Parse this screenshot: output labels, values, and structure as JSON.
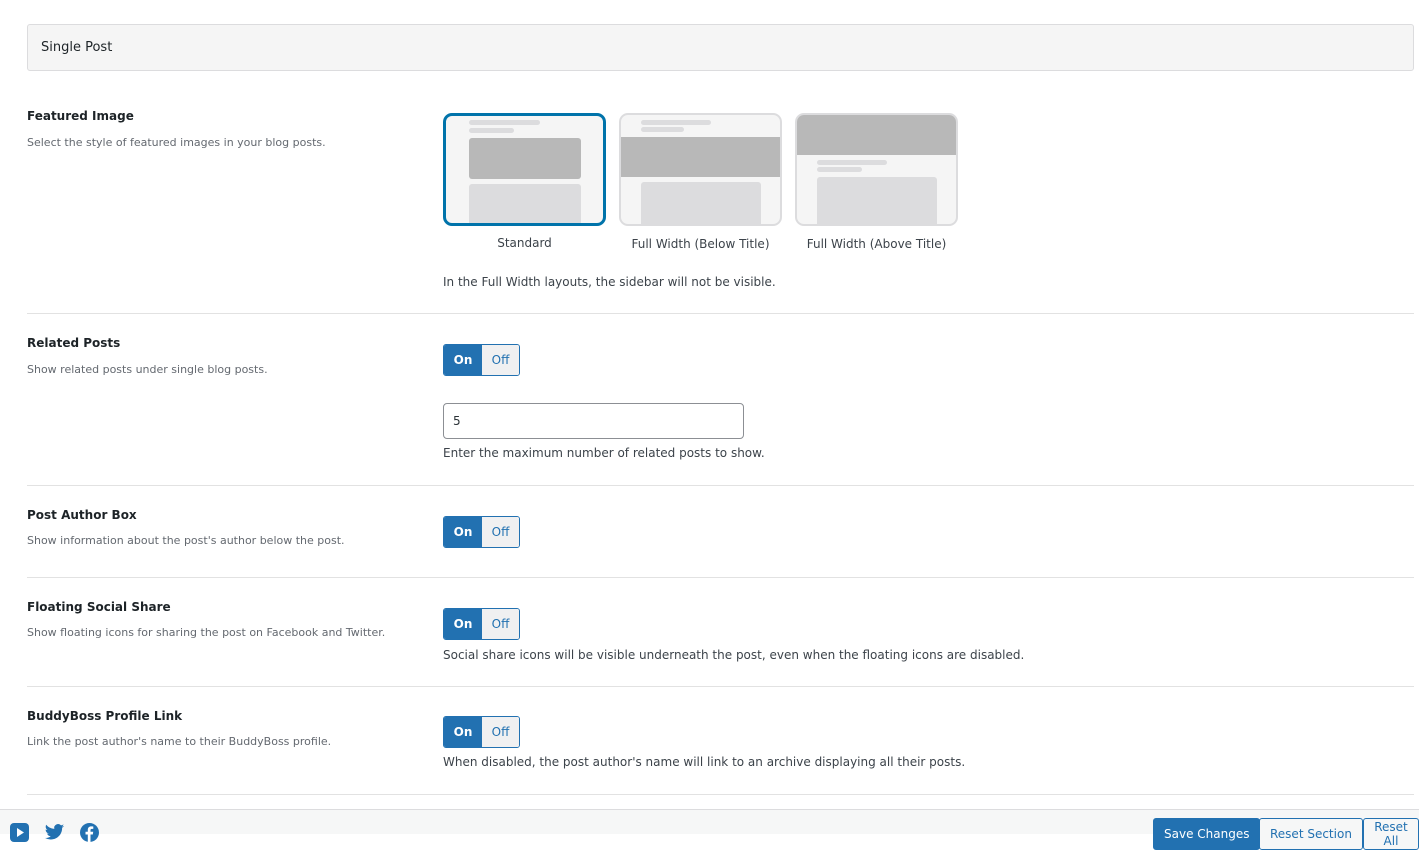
{
  "section": {
    "title": "Single Post"
  },
  "settings": {
    "featured_image": {
      "label": "Featured Image",
      "description": "Select the style of featured images in your blog posts.",
      "options": [
        {
          "label": "Standard",
          "selected": true
        },
        {
          "label": "Full Width (Below Title)",
          "selected": false
        },
        {
          "label": "Full Width (Above Title)",
          "selected": false
        }
      ],
      "help": "In the Full Width layouts, the sidebar will not be visible."
    },
    "related_posts": {
      "label": "Related Posts",
      "description": "Show related posts under single blog posts.",
      "toggle": {
        "on": "On",
        "off": "Off",
        "value": "On"
      },
      "count_value": "5",
      "help": "Enter the maximum number of related posts to show."
    },
    "post_author_box": {
      "label": "Post Author Box",
      "description": "Show information about the post's author below the post.",
      "toggle": {
        "on": "On",
        "off": "Off",
        "value": "On"
      }
    },
    "floating_social_share": {
      "label": "Floating Social Share",
      "description": "Show floating icons for sharing the post on Facebook and Twitter.",
      "toggle": {
        "on": "On",
        "off": "Off",
        "value": "On"
      },
      "help": "Social share icons will be visible underneath the post, even when the floating icons are disabled."
    },
    "buddyboss_profile_link": {
      "label": "BuddyBoss Profile Link",
      "description": "Link the post author's name to their BuddyBoss profile.",
      "toggle": {
        "on": "On",
        "off": "Off",
        "value": "On"
      },
      "help": "When disabled, the post author's name will link to an archive displaying all their posts."
    }
  },
  "footer": {
    "social_icons": [
      "youtube-icon",
      "twitter-icon",
      "facebook-icon"
    ],
    "buttons": {
      "save": "Save Changes",
      "reset_section": "Reset Section",
      "reset_all": "Reset All"
    }
  },
  "colors": {
    "accent": "#2271b1",
    "selected_border": "#0073aa"
  }
}
